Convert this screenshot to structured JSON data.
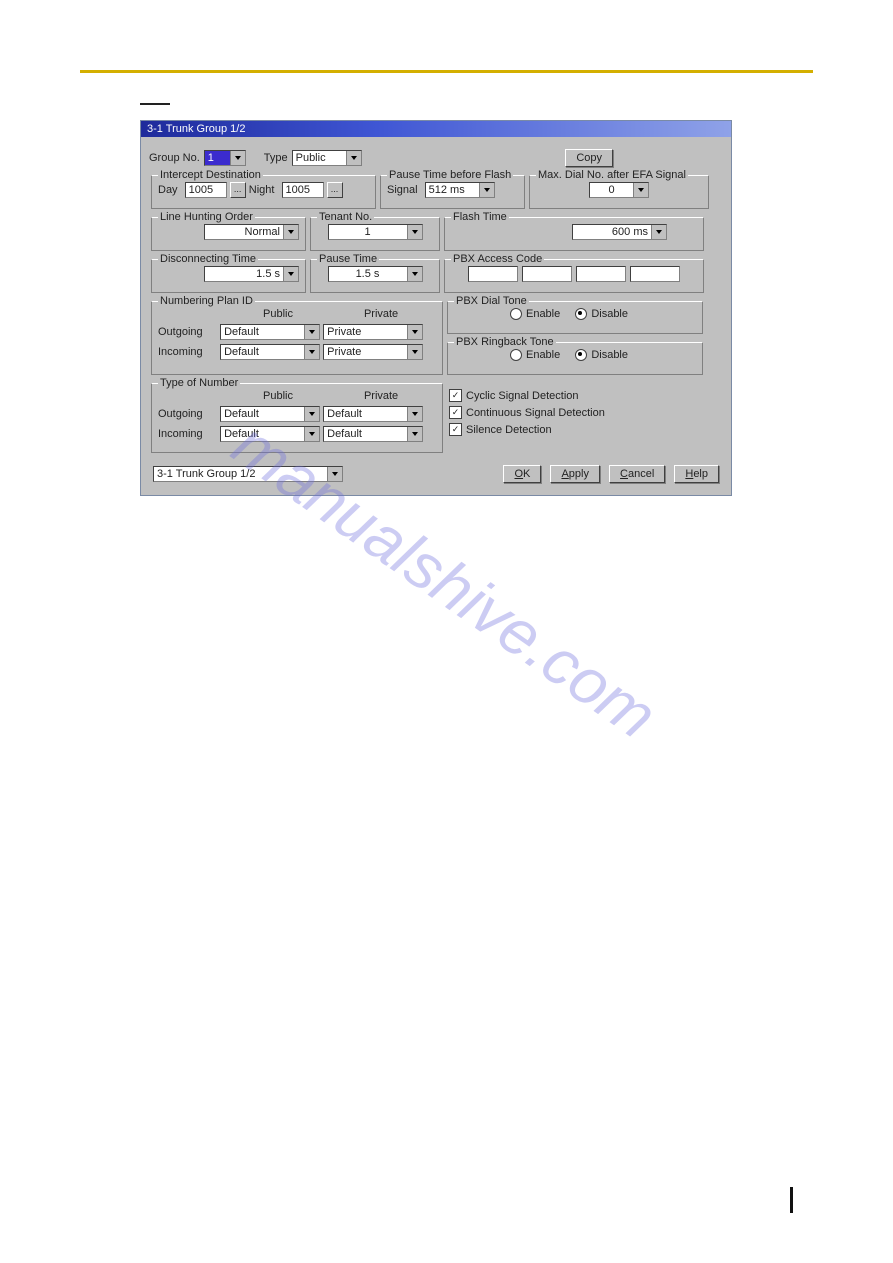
{
  "watermark": "manualshive.com",
  "dialog": {
    "title": "3-1 Trunk Group 1/2",
    "top": {
      "group_no_label": "Group No.",
      "group_no_value": "1",
      "type_label": "Type",
      "type_value": "Public",
      "copy_label": "Copy"
    },
    "intercept": {
      "legend": "Intercept Destination",
      "day_label": "Day",
      "day_value": "1005",
      "night_label": "Night",
      "night_value": "1005"
    },
    "pause_flash": {
      "legend": "Pause Time before Flash",
      "signal_label": "Signal",
      "value": "512 ms"
    },
    "max_dial": {
      "legend": "Max. Dial No. after EFA Signal",
      "value": "0"
    },
    "line_hunting": {
      "legend": "Line Hunting Order",
      "value": "Normal"
    },
    "tenant": {
      "legend": "Tenant No.",
      "value": "1"
    },
    "flash": {
      "legend": "Flash Time",
      "value": "600 ms"
    },
    "disconnect": {
      "legend": "Disconnecting Time",
      "value": "1.5 s"
    },
    "pause": {
      "legend": "Pause Time",
      "value": "1.5 s"
    },
    "pbx_access": {
      "legend": "PBX Access Code"
    },
    "numbering": {
      "legend": "Numbering Plan ID",
      "col_public": "Public",
      "col_private": "Private",
      "out_label": "Outgoing",
      "out_public": "Default",
      "out_private": "Private",
      "in_label": "Incoming",
      "in_public": "Default",
      "in_private": "Private"
    },
    "type_number": {
      "legend": "Type of Number",
      "col_public": "Public",
      "col_private": "Private",
      "out_label": "Outgoing",
      "out_public": "Default",
      "out_private": "Default",
      "in_label": "Incoming",
      "in_public": "Default",
      "in_private": "Default"
    },
    "pbx_dial": {
      "legend": "PBX Dial Tone",
      "enable": "Enable",
      "disable": "Disable"
    },
    "pbx_ringback": {
      "legend": "PBX Ringback Tone",
      "enable": "Enable",
      "disable": "Disable"
    },
    "checks": {
      "cyclic": "Cyclic Signal Detection",
      "continuous": "Continuous Signal Detection",
      "silence": "Silence Detection"
    },
    "bottom": {
      "nav_value": "3-1 Trunk Group 1/2",
      "ok": "OK",
      "apply": "Apply",
      "cancel": "Cancel",
      "help": "Help"
    }
  }
}
